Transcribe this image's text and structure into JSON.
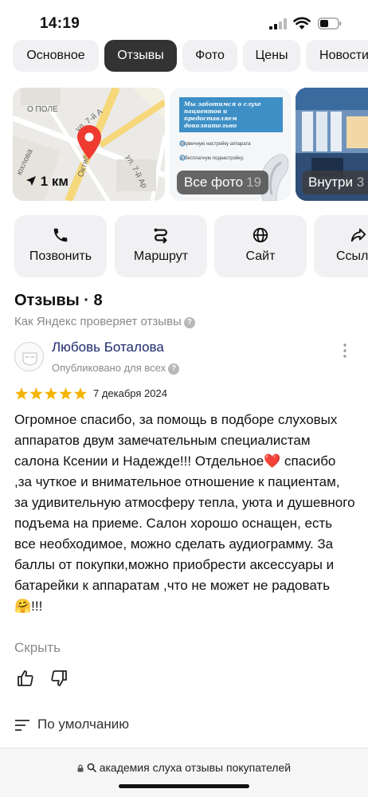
{
  "status": {
    "time": "14:19"
  },
  "tabs": [
    {
      "label": "Основное",
      "active": false
    },
    {
      "label": "Отзывы",
      "active": true
    },
    {
      "label": "Фото",
      "active": false
    },
    {
      "label": "Цены",
      "active": false
    },
    {
      "label": "Новости",
      "active": false
    }
  ],
  "map": {
    "distance": "1 км",
    "streets": [
      "О ПОЛЕ",
      "ул. 7-й А",
      "ул. 7-й Ар",
      "Октября",
      "юхлова"
    ]
  },
  "photo_flyer": {
    "headline": "Мы заботимся о слухе пациентов и предоставляем дополнительно",
    "line1": "первичную настройку аппарата",
    "line2": "и бесплатную поднастройку;"
  },
  "all_photos": {
    "label": "Все фото",
    "count": "19"
  },
  "inside_photo": {
    "label": "Внутри",
    "count": "3"
  },
  "actions": [
    {
      "label": "Позвонить",
      "icon": "phone-icon"
    },
    {
      "label": "Маршрут",
      "icon": "route-icon"
    },
    {
      "label": "Сайт",
      "icon": "globe-icon"
    },
    {
      "label": "Ссылка",
      "icon": "share-icon"
    }
  ],
  "reviews": {
    "title": "Отзывы · 8",
    "check_link": "Как Яндекс проверяет отзывы",
    "items": [
      {
        "author": "Любовь Боталова",
        "published": "Опубликовано для всех",
        "rating": 5,
        "date": "7 декабря 2024",
        "text": "Огромное спасибо, за помощь в подборе слуховых аппаратов двум замечательным специалистам салона Ксении и Надежде!!! Отдельное❤️ спасибо ,за чуткое и внимательное отношение к пациентам, за удивительную атмосферу тепла, уюта и душевного подъема на приеме. Салон хорошо оснащен, есть все необходимое, можно сделать аудиограмму. За баллы от покупки,можно приобрести аксессуары и батарейки к аппаратам ,что не может не радовать 🤗!!!",
        "hide": "Скрыть"
      }
    ],
    "sort": "По умолчанию"
  },
  "browser": {
    "url": "академия слуха отзывы покупателей"
  },
  "colors": {
    "accent_dark": "#333333",
    "star": "#f5b400",
    "pin": "#ee3a2f",
    "author": "#1c2a6b"
  }
}
